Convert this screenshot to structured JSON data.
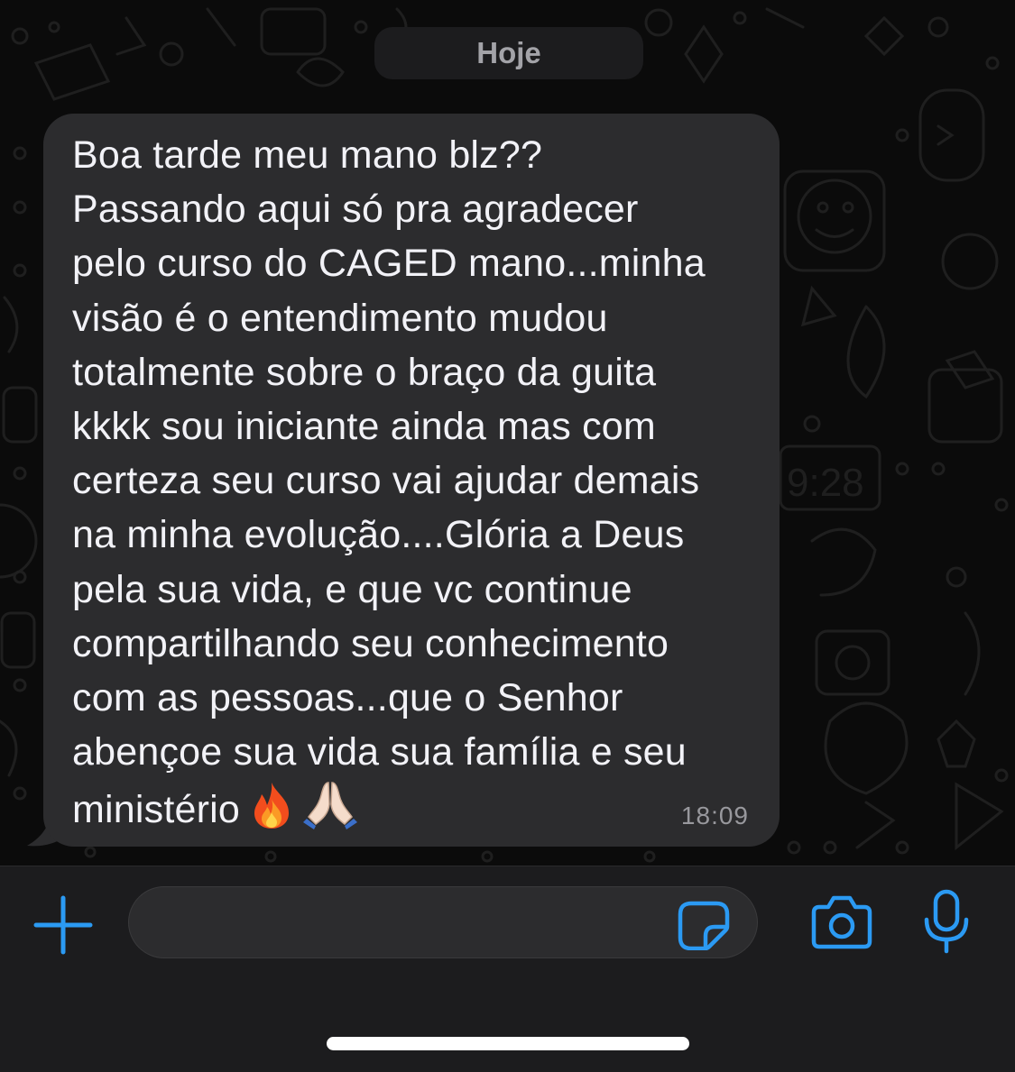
{
  "date_separator": "Hoje",
  "message": {
    "text": "Boa tarde meu mano blz??\nPassando aqui só pra agradecer\npelo curso do CAGED mano...minha\nvisão é o entendimento mudou\ntotalmente sobre o braço da guita\nkkkk sou iniciante ainda mas com\ncerteza seu curso vai ajudar demais\nna minha evolução....Glória a Deus\npela sua vida, e que vc continue\ncompartilhando seu conhecimento\ncom as pessoas...que o Senhor\nabençoe sua vida sua família e seu\nministério",
    "emojis": [
      "🔥",
      "🙏🏻"
    ],
    "time": "18:09"
  },
  "input_bar": {
    "placeholder": "",
    "value": "",
    "icons": [
      "plus-icon",
      "sticker-icon",
      "camera-icon",
      "microphone-icon"
    ],
    "accent_color": "#2b9af3"
  },
  "colors": {
    "background": "#0b0b0b",
    "bubble": "#2c2c2e",
    "text": "#f2f2f7",
    "timestamp": "#98989d"
  }
}
